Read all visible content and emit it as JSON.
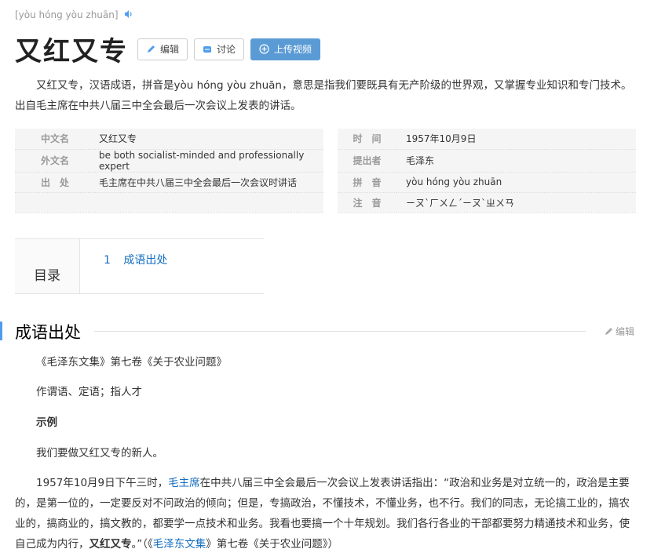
{
  "pinyin_header": "[yòu hóng yòu zhuān]",
  "title": "又红又专",
  "toolbar": {
    "edit_label": "编辑",
    "discuss_label": "讨论",
    "upload_label": "上传视频"
  },
  "summary": "又红又专，汉语成语，拼音是yòu hóng yòu zhuān，意思是指我们要既具有无产阶级的世界观，又掌握专业知识和专门技术。出自毛主席在中共八届三中全会最后一次会议上发表的讲话。",
  "basic_info": [
    {
      "label": "中文名",
      "value": "又红又专",
      "label2": "时　间",
      "value2": "1957年10月9日"
    },
    {
      "label": "外文名",
      "value": "be both socialist-minded and professionally expert",
      "label2": "提出者",
      "value2": "毛泽东"
    },
    {
      "label": "出　处",
      "value": "毛主席在中共八届三中全会最后一次会议时讲话",
      "label2": "拼　音",
      "value2": "yòu hóng yòu zhuān"
    },
    {
      "label": "",
      "value": "",
      "label2": "注　音",
      "value2": "ㄧㄡˋㄏㄨㄥˊㄧㄡˋㄓㄨㄢ"
    }
  ],
  "catalog": {
    "title": "目录",
    "items": [
      {
        "num": "1",
        "label": "成语出处"
      }
    ]
  },
  "section": {
    "title": "成语出处",
    "edit_label": "编辑"
  },
  "paragraphs": {
    "p1": "《毛泽东文集》第七卷《关于农业问题》",
    "p2": "作谓语、定语；指人才",
    "p3": "示例",
    "p4": "我们要做又红又专的新人。",
    "p5_a": "1957年10月9日下午三时，",
    "p5_link1": "毛主席",
    "p5_b": "在中共八届三中全会最后一次会议上发表讲话指出：“政治和业务是对立统一的，政治是主要的，是第一位的，一定要反对不问政治的倾向；但是，专搞政治，不懂技术，不懂业务，也不行。我们的同志，无论搞工业的，搞农业的，搞商业的，搞文教的，都要学一点技术和业务。我看也要搞一个十年规划。我们各行各业的干部都要努力精通技术和业务，使自己成为内行，",
    "p5_bold": "又红又专",
    "p5_c": "。”（《",
    "p5_link2": "毛泽东文集",
    "p5_d": "》第七卷《关于农业问题》）"
  },
  "colors": {
    "link": "#136ec2",
    "upload_button": "#5b9bd5",
    "section_bar": "#4f9cee"
  }
}
